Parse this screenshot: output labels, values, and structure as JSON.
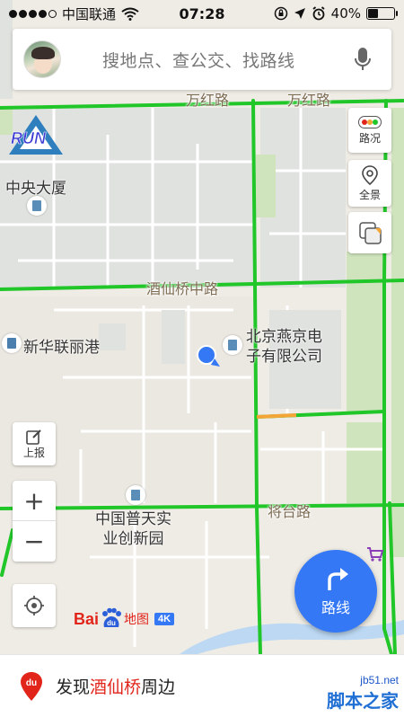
{
  "status_bar": {
    "carrier": "中国联通",
    "time": "07:28",
    "battery_text": "40%",
    "battery_level": 0.4
  },
  "search": {
    "placeholder": "搜地点、查公交、找路线",
    "mic_icon": "microphone-icon"
  },
  "right_tools": [
    {
      "label": "路况",
      "icon": "traffic-light-icon"
    },
    {
      "label": "全景",
      "icon": "panorama-pin-icon"
    },
    {
      "label": "",
      "icon": "layers-icon"
    }
  ],
  "left_tools": {
    "report_label": "上报",
    "zoom_in": "+",
    "zoom_out": "−",
    "locate_icon": "locate-icon"
  },
  "route_button": {
    "label": "路线"
  },
  "map": {
    "roads": [
      "万红路",
      "万红路",
      "酒仙桥中路",
      "将台路"
    ],
    "places": [
      "中央大厦",
      "新华联丽港",
      "北京燕京电子有限公司",
      "中国普天实业创新园"
    ],
    "place_lines": {
      "beijing_yanjing_1": "北京燕京电",
      "beijing_yanjing_2": "子有限公司",
      "putian_1": "中国普天实",
      "putian_2": "业创新园"
    },
    "brand_logo": "RUN"
  },
  "logo": {
    "bai": "Bai",
    "du": "du",
    "ditu": "地图",
    "badge": "4K"
  },
  "bottom": {
    "prefix": "发现",
    "highlight": "酒仙桥",
    "suffix": "周边"
  },
  "watermark": {
    "url": "jb51.net",
    "name": "脚本之家"
  },
  "colors": {
    "road_green": "#21c629",
    "road_orange": "#f3a536",
    "accent_blue": "#3478f6",
    "baidu_red": "#e1251b",
    "block_fill": "#dfe2df"
  }
}
